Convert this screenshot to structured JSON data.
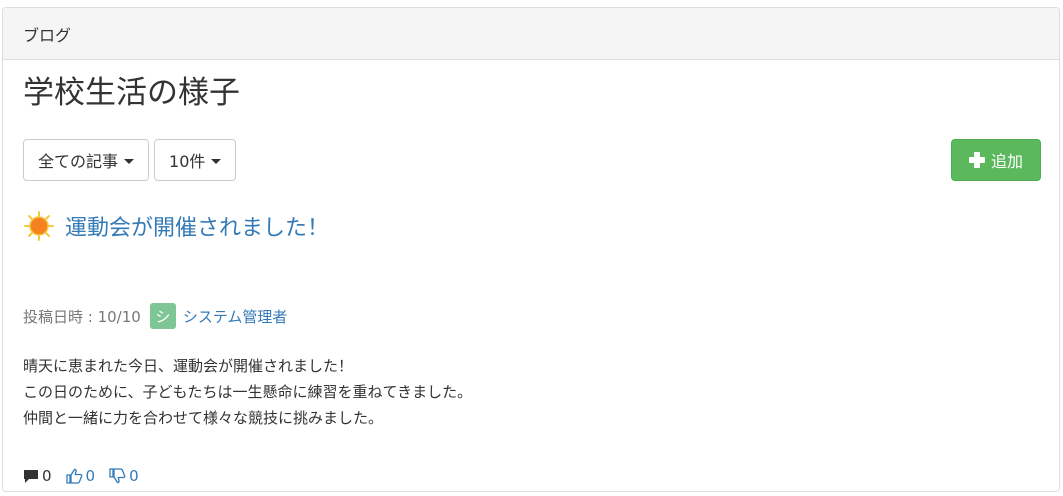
{
  "panel": {
    "heading": "ブログ"
  },
  "page": {
    "title": "学校生活の様子"
  },
  "toolbar": {
    "filter_label": "全ての記事",
    "per_page_label": "10件",
    "add_label": "追加"
  },
  "post": {
    "title": "運動会が開催されました！",
    "date_label": "投稿日時 : 10/10",
    "avatar_initial": "シ",
    "author": "システム管理者",
    "body": [
      "晴天に恵まれた今日、運動会が開催されました！",
      "この日のために、子どもたちは一生懸命に練習を重ねてきました。",
      "仲間と一緒に力を合わせて様々な競技に挑みました。"
    ],
    "comments": "0",
    "likes": "0",
    "dislikes": "0"
  },
  "colors": {
    "link": "#337ab7",
    "success": "#5cb85c",
    "avatar": "#7ec695",
    "heading_bg": "#f5f5f5"
  }
}
